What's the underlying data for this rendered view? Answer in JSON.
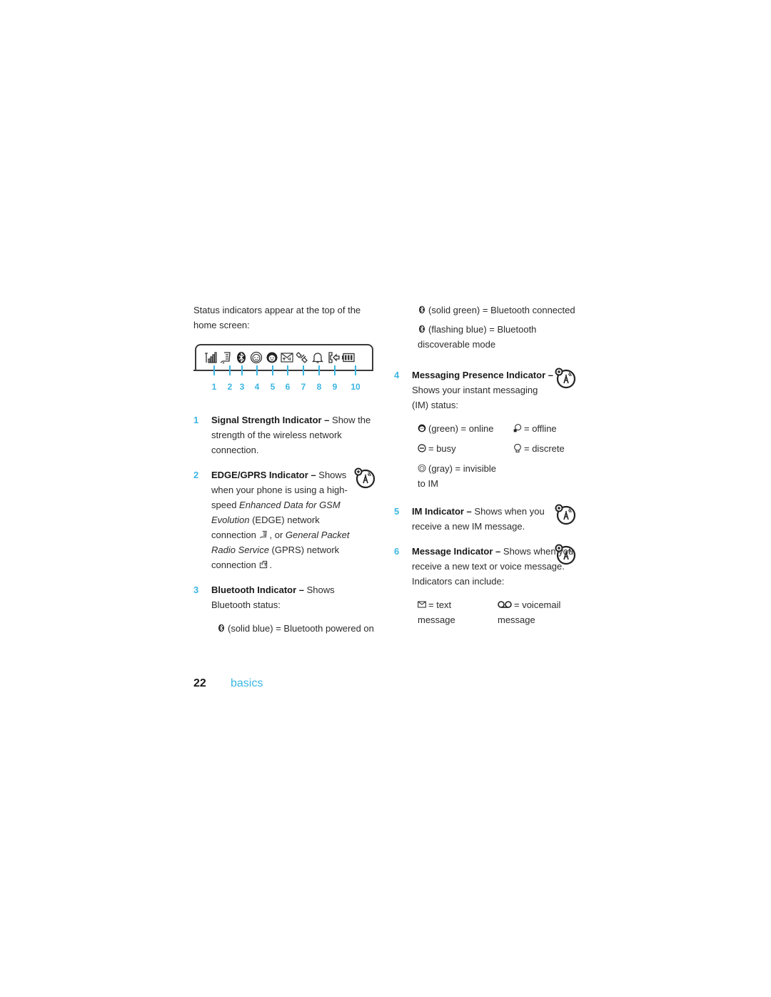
{
  "left": {
    "intro": "Status indicators appear at the top of the home screen:",
    "status_bar": {
      "icons": [
        "signal-strength-icon",
        "edge-gprs-icon",
        "bluetooth-icon",
        "messaging-presence-icon",
        "im-icon",
        "message-icon",
        "location-icon",
        "alert-icon",
        "call-icon",
        "battery-icon"
      ],
      "numbers": [
        "1",
        "2",
        "3",
        "4",
        "5",
        "6",
        "7",
        "8",
        "9",
        "10"
      ]
    },
    "items": [
      {
        "num": "1",
        "title": "Signal Strength Indicator –",
        "text": " Show the strength of the wireless network connection."
      },
      {
        "num": "2",
        "title": "EDGE/GPRS Indicator –",
        "text_a": " Shows when your phone is using a high-speed ",
        "em_a": "Enhanced Data for GSM Evolution",
        "text_b": " (EDGE) network connection ",
        "text_c": ", or ",
        "em_b": "General Packet Radio Service",
        "text_d": " (GPRS) network connection ",
        "text_e": "."
      },
      {
        "num": "3",
        "title": "Bluetooth Indicator –",
        "text": " Shows Bluetooth status:",
        "sub": "(solid blue) = Bluetooth powered on"
      }
    ]
  },
  "right": {
    "bt_states": [
      "(solid green) = Bluetooth connected",
      "(flashing blue) = Bluetooth discoverable mode"
    ],
    "items": [
      {
        "num": "4",
        "title": "Messaging Presence Indicator –",
        "text": " Shows your instant messaging (IM) status:",
        "states": [
          "(green) = online",
          "= offline",
          "= busy",
          "= discrete",
          "(gray) = invisible to IM"
        ]
      },
      {
        "num": "5",
        "title": "IM Indicator –",
        "text": " Shows when you receive a new IM message."
      },
      {
        "num": "6",
        "title": "Message Indicator –",
        "text": " Shows when you receive a new text or voice message. Indicators can include:",
        "types": [
          "= text message",
          "= voicemail message"
        ]
      }
    ]
  },
  "footer": {
    "page_number": "22",
    "section": "basics"
  },
  "colors": {
    "accent": "#3cb6e3",
    "text": "#2b2b2b"
  }
}
